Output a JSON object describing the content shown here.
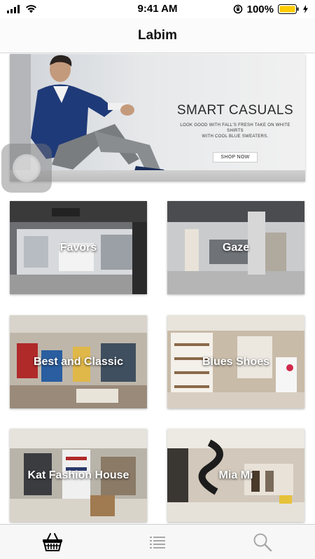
{
  "status_bar": {
    "time": "9:41 AM",
    "battery": "100%"
  },
  "nav": {
    "title": "Labim"
  },
  "banner": {
    "title": "SMART CASUALS",
    "subtitle_line1": "LOOK GOOD WITH FALL'S FRESH TAKE ON WHITE SHIRTS",
    "subtitle_line2": "WITH COOL BLUE SWEATERS.",
    "button": "SHOP NOW"
  },
  "stores": [
    {
      "name": "Favors"
    },
    {
      "name": "Gaze"
    },
    {
      "name": "Best and Classic"
    },
    {
      "name": "Blues Shoes"
    },
    {
      "name": "Kat Fashion House"
    },
    {
      "name": "Mia Mi"
    }
  ],
  "tabs": [
    {
      "icon": "basket-icon"
    },
    {
      "icon": "list-icon"
    },
    {
      "icon": "search-icon"
    }
  ],
  "colors": {
    "accent": "#000000",
    "inactive": "#a8a8a8",
    "battery": "#ffcc00"
  }
}
